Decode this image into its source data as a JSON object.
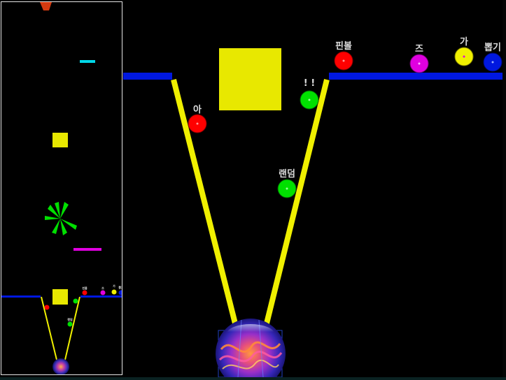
{
  "game": {
    "colors": {
      "background": "#000000",
      "platform": "#0018e0",
      "funnel_wall": "#f0f000",
      "block": "#e8e800",
      "spinner": "#00e000",
      "minimap_border": "#e6e6e6",
      "cyan_bar": "#00d8e8",
      "magenta_bar": "#e000e0"
    },
    "balls": [
      {
        "label": "아",
        "color": "#ff0000"
      },
      {
        "label": "! !",
        "color": "#00e000"
      },
      {
        "label": "랜덤",
        "color": "#00e000"
      },
      {
        "label": "핀볼",
        "color": "#ff0000"
      },
      {
        "label": "즈",
        "color": "#e000e0"
      },
      {
        "label": "가",
        "color": "#f0f000"
      },
      {
        "label": "뽑기",
        "color": "#0018e0"
      }
    ],
    "goal": {
      "icon": "glowing-orb-icon"
    }
  }
}
